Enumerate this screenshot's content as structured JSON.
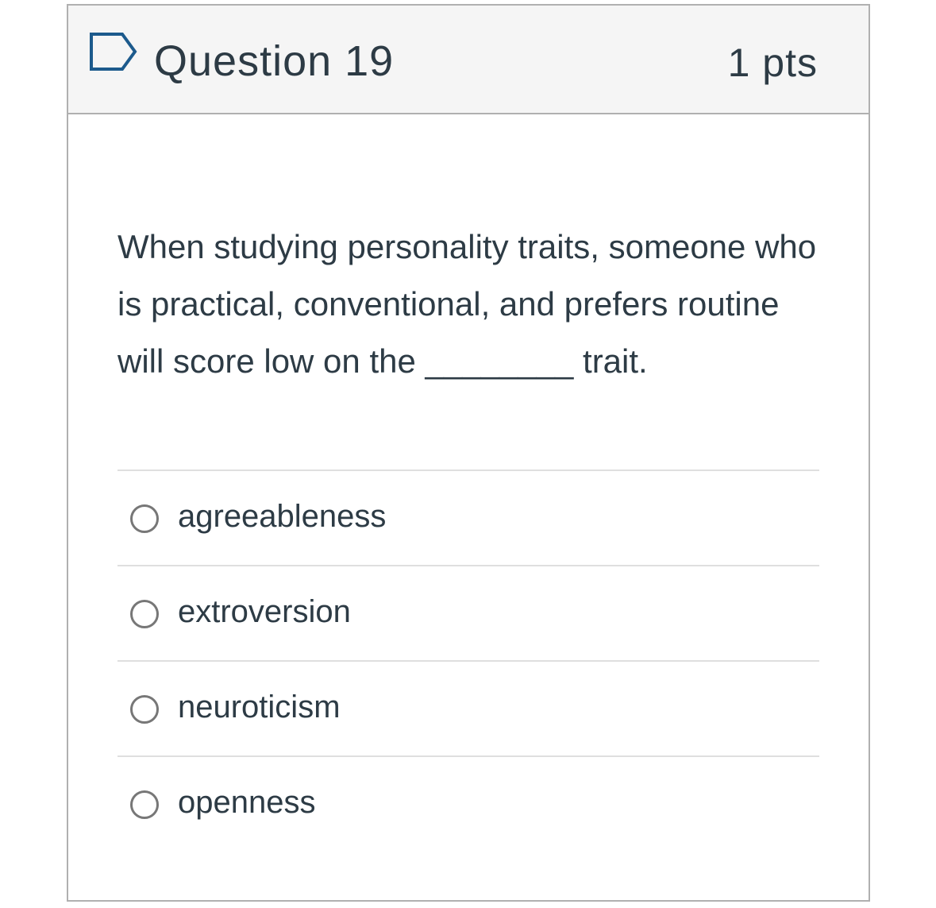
{
  "question": {
    "title": "Question 19",
    "points": "1 pts",
    "flag_icon": "flag-outline-icon",
    "text": "When studying personality traits, someone who is practical, conventional, and prefers routine will score low on the ________ trait.",
    "answers": [
      {
        "label": "agreeableness",
        "selected": false
      },
      {
        "label": "extroversion",
        "selected": false
      },
      {
        "label": "neuroticism",
        "selected": false
      },
      {
        "label": "openness",
        "selected": false
      }
    ]
  },
  "colors": {
    "text": "#2d3b45",
    "header_bg": "#f5f5f5",
    "border": "#b0b0b0",
    "divider": "#dfdfdf",
    "flag": "#1c5a8c",
    "radio": "#777777"
  }
}
